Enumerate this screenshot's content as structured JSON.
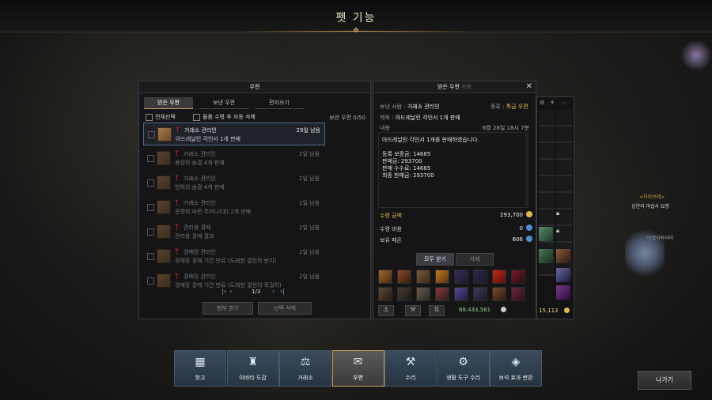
{
  "page_title": "펫 기능",
  "mail": {
    "title": "우편",
    "tabs": [
      "받은 우편",
      "보낸 우편",
      "편지쓰기"
    ],
    "select_all": "전체선택",
    "auto_delete": "물품 수령 후 자동 삭제",
    "storage": "보관 우편 0/50",
    "items": [
      {
        "sender": "거래소 관리인",
        "subject": "아드레날린 각인서 1개 판매",
        "days": "29일 남음"
      },
      {
        "sender": "거래소 관리인",
        "subject": "용암의 숨결 4개 판매",
        "days": "2일 남음"
      },
      {
        "sender": "거래소 관리인",
        "subject": "빙하의 숨결 4개 판매",
        "days": "2일 남음"
      },
      {
        "sender": "거래소 관리인",
        "subject": "운명의 파편 주머니(대) 2개 판매",
        "days": "2일 남음"
      },
      {
        "sender": "관리용 경매",
        "subject": "관리용 경매 결과",
        "days": "2일 남음"
      },
      {
        "sender": "경매장 관리인",
        "subject": "경매장 경매 기간 만료 (도래한 결전의 반지)",
        "days": "2일 남음"
      },
      {
        "sender": "경매장 관리인",
        "subject": "경매장 경매 기간 만료 (도래한 결전의 목걸이)",
        "days": "2일 남음"
      }
    ],
    "page": "1/3",
    "buttons": {
      "receive_attachments": "첨부 받기",
      "delete_selected": "선택 삭제"
    }
  },
  "detail": {
    "title": "받은 우편",
    "title_suffix": "자동",
    "sender_label": "보낸 사람 :",
    "sender": "거래소 관리인",
    "type_label": "종류 :",
    "type": "특급 우편",
    "subject_label": "제목 :",
    "subject": "아드레날린 각인서 1개 판매",
    "content_label": "내용",
    "date": "6월 28일 18시 7분",
    "body": [
      "아드레날린 각인서 1개를 판매하였습니다.",
      "",
      "등록 보증금: 14685",
      "판매금: 293700",
      "판매 수수료: 14685",
      "최종 판매금: 293700"
    ],
    "receive_amount_label": "수령 금액",
    "receive_amount": "293,700",
    "receive_cost_label": "수령 비용",
    "receive_cost": "0",
    "owned_phoenix_label": "보유 페온",
    "owned_phoenix": "606",
    "receive_all": "모두 받기",
    "delete": "삭제"
  },
  "inventory": {
    "silver": "88,433,561",
    "gold": "15,113"
  },
  "world_text": {
    "label1": "<차이브레>",
    "label2": "심연의 마법사 묘향",
    "label3": "마법사의사이"
  },
  "nav": [
    {
      "label": "창고",
      "icon": "▦"
    },
    {
      "label": "아바타 도감",
      "icon": "♜"
    },
    {
      "label": "거래소",
      "icon": "⚖"
    },
    {
      "label": "우편",
      "icon": "✉"
    },
    {
      "label": "수리",
      "icon": "⚒"
    },
    {
      "label": "생활 도구 수리",
      "icon": "⚙"
    },
    {
      "label": "보석 효과 변환",
      "icon": "◈"
    }
  ],
  "exit": "나가기",
  "colors": {
    "accent_gold": "#c9a35a",
    "amount_gold": "#e1b64a",
    "unread_mark": "#d02828"
  }
}
